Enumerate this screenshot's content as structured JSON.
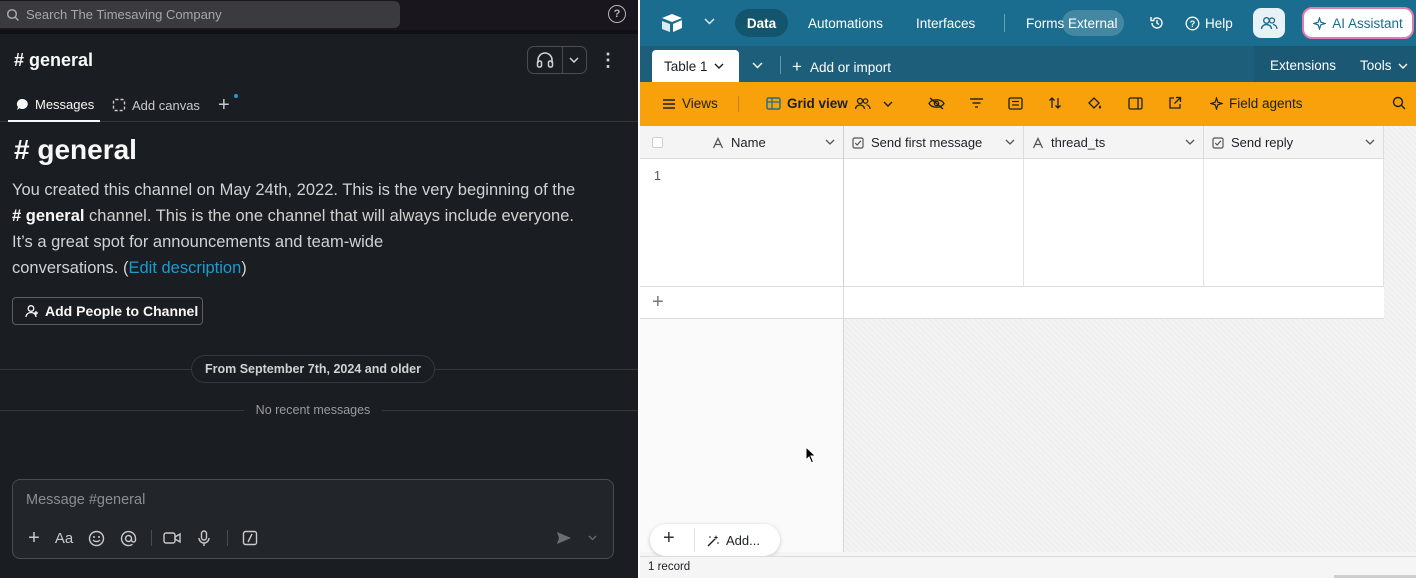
{
  "slack": {
    "search_placeholder": "Search The Timesaving Company",
    "help_icon": "?",
    "channel_title": "# general",
    "tabs": [
      {
        "label": "Messages"
      },
      {
        "label": "Add canvas"
      }
    ],
    "intro": {
      "title": "# general",
      "line1": "You created this channel on May 24th, 2022. This is the very beginning of the",
      "channel_ref": "# general",
      "line2": " channel. This is the one channel that will always include everyone.",
      "line3": "It’s a great spot for announcements and team-wide",
      "line4_pre": "conversations. (",
      "edit_link": "Edit description",
      "line4_post": ")"
    },
    "add_people_label": "Add People to Channel",
    "date_divider": "From September 7th, 2024 and older",
    "no_recent": "No recent messages",
    "composer_placeholder": "Message #general",
    "composer_format_label": "Aa"
  },
  "airtable": {
    "nav": {
      "data": "Data",
      "automations": "Automations",
      "interfaces": "Interfaces",
      "forms": "Forms",
      "external": "External",
      "help": "Help",
      "ai_assistant": "AI Assistant"
    },
    "table_tab": "Table 1",
    "add_import": "Add or import",
    "extensions": "Extensions",
    "tools": "Tools",
    "viewbar": {
      "views": "Views",
      "grid_view": "Grid view",
      "field_agents": "Field agents"
    },
    "columns": [
      {
        "label": "Name",
        "type_icon": "text-type-icon"
      },
      {
        "label": "Send first message",
        "type_icon": "checkbox-type-icon"
      },
      {
        "label": "thread_ts",
        "type_icon": "text-type-icon"
      },
      {
        "label": "Send reply",
        "type_icon": "checkbox-type-icon"
      }
    ],
    "rows": [
      {
        "number": "1"
      }
    ],
    "add_button": "Add...",
    "record_count": "1 record"
  },
  "colors": {
    "slack_bg": "#1a1d21",
    "slack_link": "#1d9bd1",
    "airtable_top": "#1a6d8e",
    "airtable_viewbar": "#f8a10a",
    "ai_border": "#e27bb0"
  }
}
